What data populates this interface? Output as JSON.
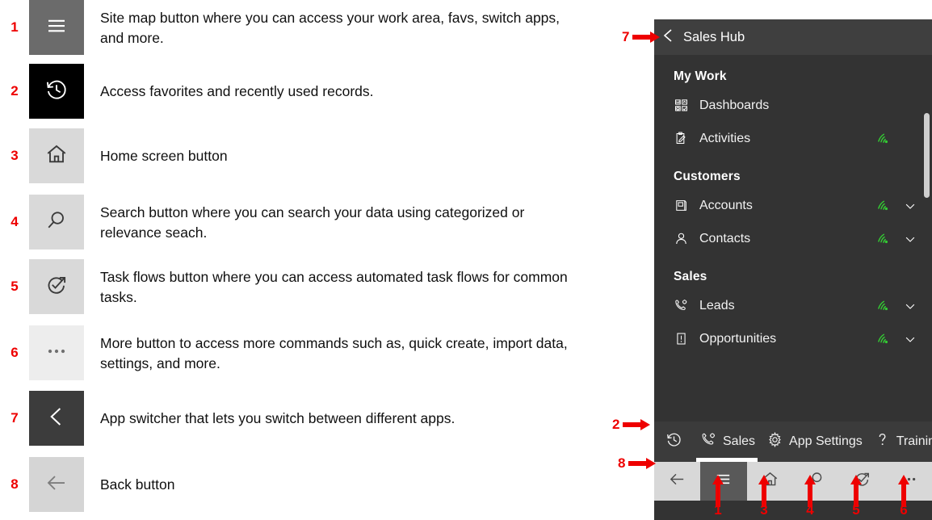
{
  "legend": {
    "items": [
      {
        "number": "1",
        "icon": "hamburger-icon",
        "swatch": "sw-dark",
        "text": "Site map button where you can access your work area, favs, switch apps, and more."
      },
      {
        "number": "2",
        "icon": "history-icon",
        "swatch": "sw-black",
        "text": "Access favorites and recently used records."
      },
      {
        "number": "3",
        "icon": "home-icon",
        "swatch": "sw-light",
        "text": "Home screen button"
      },
      {
        "number": "4",
        "icon": "search-icon",
        "swatch": "sw-light",
        "text": "Search button where you can search your data using categorized or relevance seach."
      },
      {
        "number": "5",
        "icon": "task-flows-icon",
        "swatch": "sw-light",
        "text": "Task flows button where you can access automated task flows for common tasks."
      },
      {
        "number": "6",
        "icon": "more-icon",
        "swatch": "sw-lighter",
        "text": "More button to access more commands such as, quick create, import data, settings, and more."
      },
      {
        "number": "7",
        "icon": "app-switcher-icon",
        "swatch": "sw-charc",
        "text": "App switcher that lets you switch between different apps."
      },
      {
        "number": "8",
        "icon": "back-arrow-icon",
        "swatch": "sw-gray2",
        "text": "Back button"
      }
    ]
  },
  "panel": {
    "header": {
      "back_icon": "chevron-left-icon",
      "title": "Sales Hub"
    },
    "groups": [
      {
        "title": "My Work",
        "items": [
          {
            "icon": "dashboards-icon",
            "label": "Dashboards",
            "offline": false,
            "chevron": false
          },
          {
            "icon": "activities-icon",
            "label": "Activities",
            "offline": true,
            "chevron": false
          }
        ]
      },
      {
        "title": "Customers",
        "items": [
          {
            "icon": "account-icon",
            "label": "Accounts",
            "offline": true,
            "chevron": true
          },
          {
            "icon": "contact-icon",
            "label": "Contacts",
            "offline": true,
            "chevron": true
          }
        ]
      },
      {
        "title": "Sales",
        "items": [
          {
            "icon": "lead-icon",
            "label": "Leads",
            "offline": true,
            "chevron": true
          },
          {
            "icon": "opportunity-icon",
            "label": "Opportunities",
            "offline": true,
            "chevron": true
          }
        ]
      }
    ],
    "toolbar": [
      {
        "icon": "history-icon",
        "label": "",
        "active": false
      },
      {
        "icon": "sales-phone-icon",
        "label": "Sales",
        "active": true
      },
      {
        "icon": "gear-icon",
        "label": "App Settings",
        "active": false
      },
      {
        "icon": "question-icon",
        "label": "Training",
        "active": false
      }
    ],
    "navbar": [
      {
        "icon": "back-arrow-icon",
        "name": "back-button",
        "active": false
      },
      {
        "icon": "hamburger-icon",
        "name": "site-map-button",
        "active": true
      },
      {
        "icon": "home-icon",
        "name": "home-button",
        "active": false
      },
      {
        "icon": "search-icon",
        "name": "search-button",
        "active": false
      },
      {
        "icon": "task-flows-icon",
        "name": "task-flows-button",
        "active": false
      },
      {
        "icon": "more-icon",
        "name": "more-button",
        "active": false
      }
    ]
  },
  "annotations": {
    "callout_7": "7",
    "callout_2": "2",
    "callout_8": "8",
    "below_1": "1",
    "below_3": "3",
    "below_4": "4",
    "below_5": "5",
    "below_6": "6"
  },
  "colors": {
    "annotation_red": "#ee0000",
    "panel_bg": "#333333",
    "panel_header_bg": "#3f3f3f",
    "toolbar_bg": "#3b3b3b",
    "navbar_bg": "#d8d8d8",
    "offline_green": "#33cc33",
    "active_tab_indicator": "#ffffff"
  }
}
